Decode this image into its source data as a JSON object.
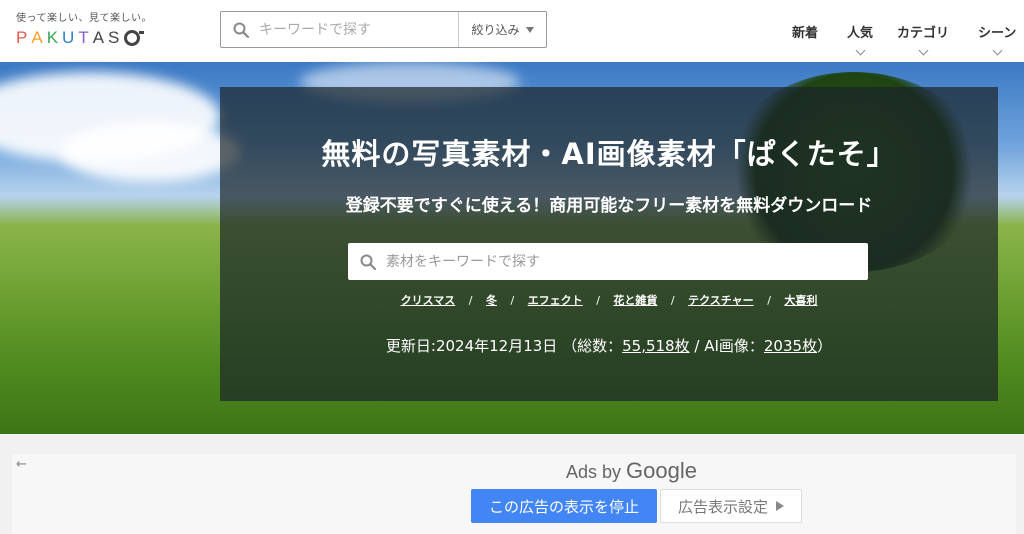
{
  "header": {
    "logo_tagline": "使って楽しい、見て楽しい。",
    "logo_letters": [
      "P",
      "A",
      "K",
      "U",
      "T",
      "A",
      "S"
    ],
    "search_placeholder": "キーワードで探す",
    "filter_label": "絞り込み",
    "nav": [
      {
        "label": "新着",
        "has_dropdown": false
      },
      {
        "label": "人気",
        "has_dropdown": true
      },
      {
        "label": "カテゴリ",
        "has_dropdown": true
      },
      {
        "label": "シーン",
        "has_dropdown": true
      }
    ]
  },
  "hero": {
    "title": "無料の写真素材・AI画像素材「ぱくたそ」",
    "subtitle": "登録不要ですぐに使える！商用可能なフリー素材を無料ダウンロード",
    "search_placeholder": "素材をキーワードで探す",
    "tags": [
      "クリスマス",
      "冬",
      "エフェクト",
      "花と雑貨",
      "テクスチャー",
      "大喜利"
    ],
    "tag_separator": "/",
    "stats": {
      "updated_prefix": "更新日:",
      "updated_date": "2024年12月13日",
      "total_prefix": "（総数：",
      "total_count": "55,518枚",
      "ai_prefix": " / AI画像：",
      "ai_count": "2035枚",
      "suffix": "）"
    }
  },
  "ads": {
    "back_arrow": "←",
    "ads_by": "Ads by ",
    "google": "Google",
    "stop_button": "この広告の表示を停止",
    "settings_button": "広告表示設定"
  },
  "icons": {
    "search": "search-icon",
    "filter_caret": "chevron-down-icon",
    "ad_settings": "play-icon"
  },
  "colors": {
    "ad_button": "#4285f4",
    "overlay": "rgba(25,35,40,0.70)"
  }
}
